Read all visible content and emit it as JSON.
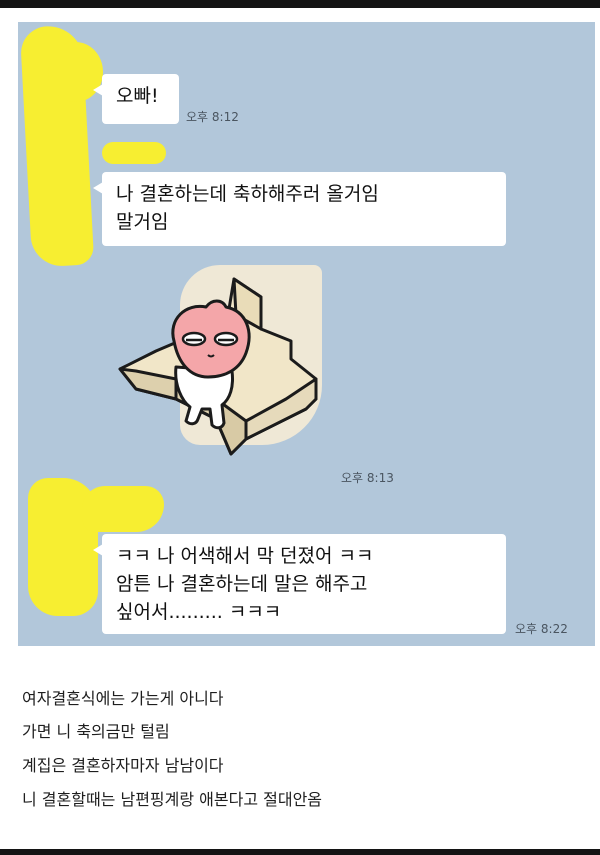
{
  "messages": [
    {
      "lines": [
        "오빠!"
      ],
      "time": "오후 8:12"
    },
    {
      "lines": [
        "나 결혼하는데 축하해주러 올거임",
        "말거임"
      ]
    },
    {
      "sticker": "peach-sitting-on-stairs-sticker",
      "time": "오후 8:13"
    },
    {
      "lines": [
        "ㅋㅋ 나 어색해서 막 던졌어 ㅋㅋ",
        "암튼 나 결혼하는데 말은 해주고",
        "싶어서......... ㅋㅋㅋ"
      ],
      "time": "오후 8:22"
    }
  ],
  "caption": [
    "여자결혼식에는 가는게 아니다",
    "가면 니 축의금만 털림",
    "계집은 결혼하자마자 남남이다",
    "니 결혼할때는 남편핑계랑 애본다고 절대안옴"
  ],
  "colors": {
    "chat_background": "#b2c7da",
    "bubble": "#ffffff",
    "redaction": "#f7ee31"
  }
}
